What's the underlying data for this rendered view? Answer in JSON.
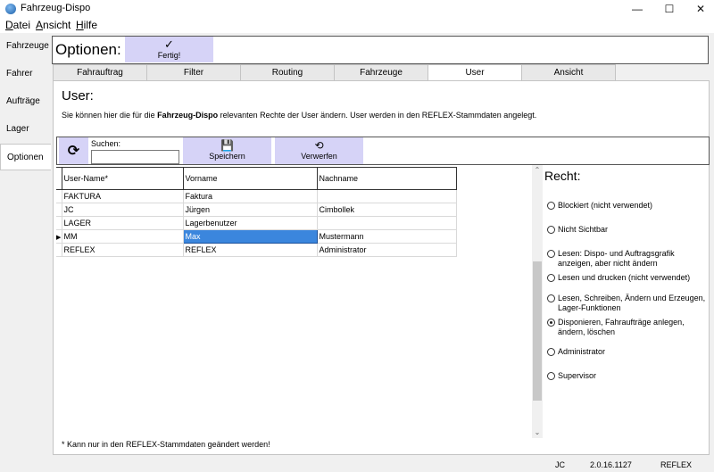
{
  "window": {
    "title": "Fahrzeug-Dispo",
    "controls": {
      "minimize": "—",
      "maximize": "☐",
      "close": "✕"
    }
  },
  "menu": [
    "Datei",
    "Ansicht",
    "Hilfe"
  ],
  "sidebar": {
    "items": [
      {
        "label": "Fahrzeuge"
      },
      {
        "label": "Fahrer"
      },
      {
        "label": "Aufträge"
      },
      {
        "label": "Lager"
      },
      {
        "label": "Optionen"
      }
    ],
    "active": "Optionen"
  },
  "header": {
    "title": "Optionen:",
    "done_button": {
      "icon": "✓",
      "label": "Fertig!"
    }
  },
  "tabs": {
    "items": [
      {
        "label": "Fahrauftrag"
      },
      {
        "label": "Filter"
      },
      {
        "label": "Routing"
      },
      {
        "label": "Fahrzeuge"
      },
      {
        "label": "User"
      },
      {
        "label": "Ansicht"
      }
    ],
    "active": "User"
  },
  "user_panel": {
    "heading": "User:",
    "info_prefix": "Sie können hier die für die ",
    "info_bold": "Fahrzeug-Dispo",
    "info_suffix": " relevanten Rechte der User ändern. User werden in den REFLEX-Stammdaten angelegt."
  },
  "toolbar": {
    "refresh_icon": "⟳",
    "search_label": "Suchen:",
    "search_value": "",
    "save": {
      "icon": "💾",
      "label": "Speichern"
    },
    "discard": {
      "icon": "⟲",
      "label": "Verwerfen"
    }
  },
  "grid": {
    "columns": [
      "User-Name*",
      "Vorname",
      "Nachname"
    ],
    "rows": [
      {
        "user": "FAKTURA",
        "vorname": "Faktura",
        "nachname": ""
      },
      {
        "user": "JC",
        "vorname": "Jürgen",
        "nachname": "Cimbollek"
      },
      {
        "user": "LAGER",
        "vorname": "Lagerbenutzer",
        "nachname": ""
      },
      {
        "user": "MM",
        "vorname": "Max",
        "nachname": "Mustermann"
      },
      {
        "user": "REFLEX",
        "vorname": "REFLEX",
        "nachname": "Administrator"
      }
    ],
    "current_row_marker": "▶"
  },
  "rights": {
    "heading": "Recht:",
    "options": [
      {
        "label": "Blockiert (nicht verwendet)",
        "selected": false
      },
      {
        "label": "Nicht Sichtbar",
        "selected": false
      },
      {
        "label": "Lesen: Dispo- und Auftragsgrafik anzeigen, aber nicht ändern",
        "selected": false
      },
      {
        "label": "Lesen und drucken (nicht verwendet)",
        "selected": false
      },
      {
        "label": "Lesen, Schreiben, Ändern und Erzeugen, Lager-Funktionen",
        "selected": false
      },
      {
        "label": "Disponieren, Fahraufträge anlegen, ändern, löschen",
        "selected": true
      },
      {
        "label": "Administrator",
        "selected": false
      },
      {
        "label": "Supervisor",
        "selected": false
      }
    ]
  },
  "footnote": "* Kann nur in den REFLEX-Stammdaten geändert werden!",
  "status": {
    "user": "JC",
    "version": "2.0.16.1127",
    "database": "REFLEX"
  }
}
